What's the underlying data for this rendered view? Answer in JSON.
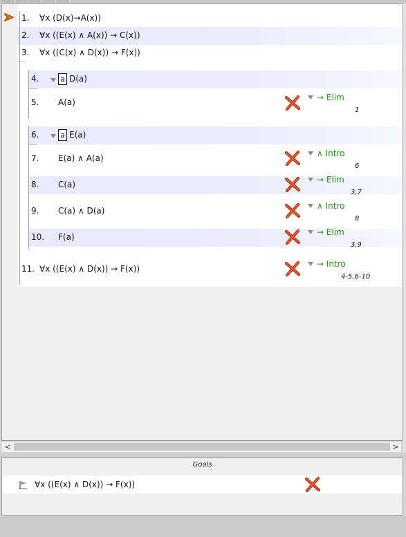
{
  "premises": [
    {
      "num": "1.",
      "formula": "∀x (D(x)→A(x))"
    },
    {
      "num": "2.",
      "formula": "∀x ((E(x) ∧ A(x)) → C(x))"
    },
    {
      "num": "3.",
      "formula": "∀x ((C(x) ∧ D(x)) → F(x))"
    }
  ],
  "subproof_a": {
    "assumption": {
      "num": "4.",
      "box": "a",
      "formula": "D(a)"
    },
    "lines": [
      {
        "num": "5.",
        "formula": "A(a)",
        "rule": "→ Elim",
        "refs": "1"
      }
    ]
  },
  "subproof_b": {
    "assumption": {
      "num": "6.",
      "box": "a",
      "formula": "E(a)"
    },
    "lines": [
      {
        "num": "7.",
        "formula": "E(a) ∧ A(a)",
        "rule": "∧ Intro",
        "refs": "6"
      },
      {
        "num": "8.",
        "formula": "C(a)",
        "rule": "→ Elim",
        "refs": "3,7"
      },
      {
        "num": "9.",
        "formula": "C(a) ∧ D(a)",
        "rule": "∧ Intro",
        "refs": "8"
      },
      {
        "num": "10.",
        "formula": "F(a)",
        "rule": "→ Elim",
        "refs": "3,9"
      }
    ]
  },
  "conclusion": {
    "num": "11.",
    "formula": "∀x ((E(x) ∧ D(x)) → F(x))",
    "rule": "→ Intro",
    "refs": "4-5,6-10"
  },
  "goals": {
    "title": "Goals",
    "items": [
      {
        "formula": "∀x ((E(x) ∧ D(x)) → F(x))"
      }
    ]
  },
  "icons": {
    "current_step": "orange-arrow-icon",
    "status_unchecked": "red-x-icon",
    "goal_marker": "goal-flag-icon"
  },
  "colors": {
    "rule_text": "#2e8b1e",
    "shaded_row": "#e9e9ff",
    "x_mark": "#d9431e"
  }
}
